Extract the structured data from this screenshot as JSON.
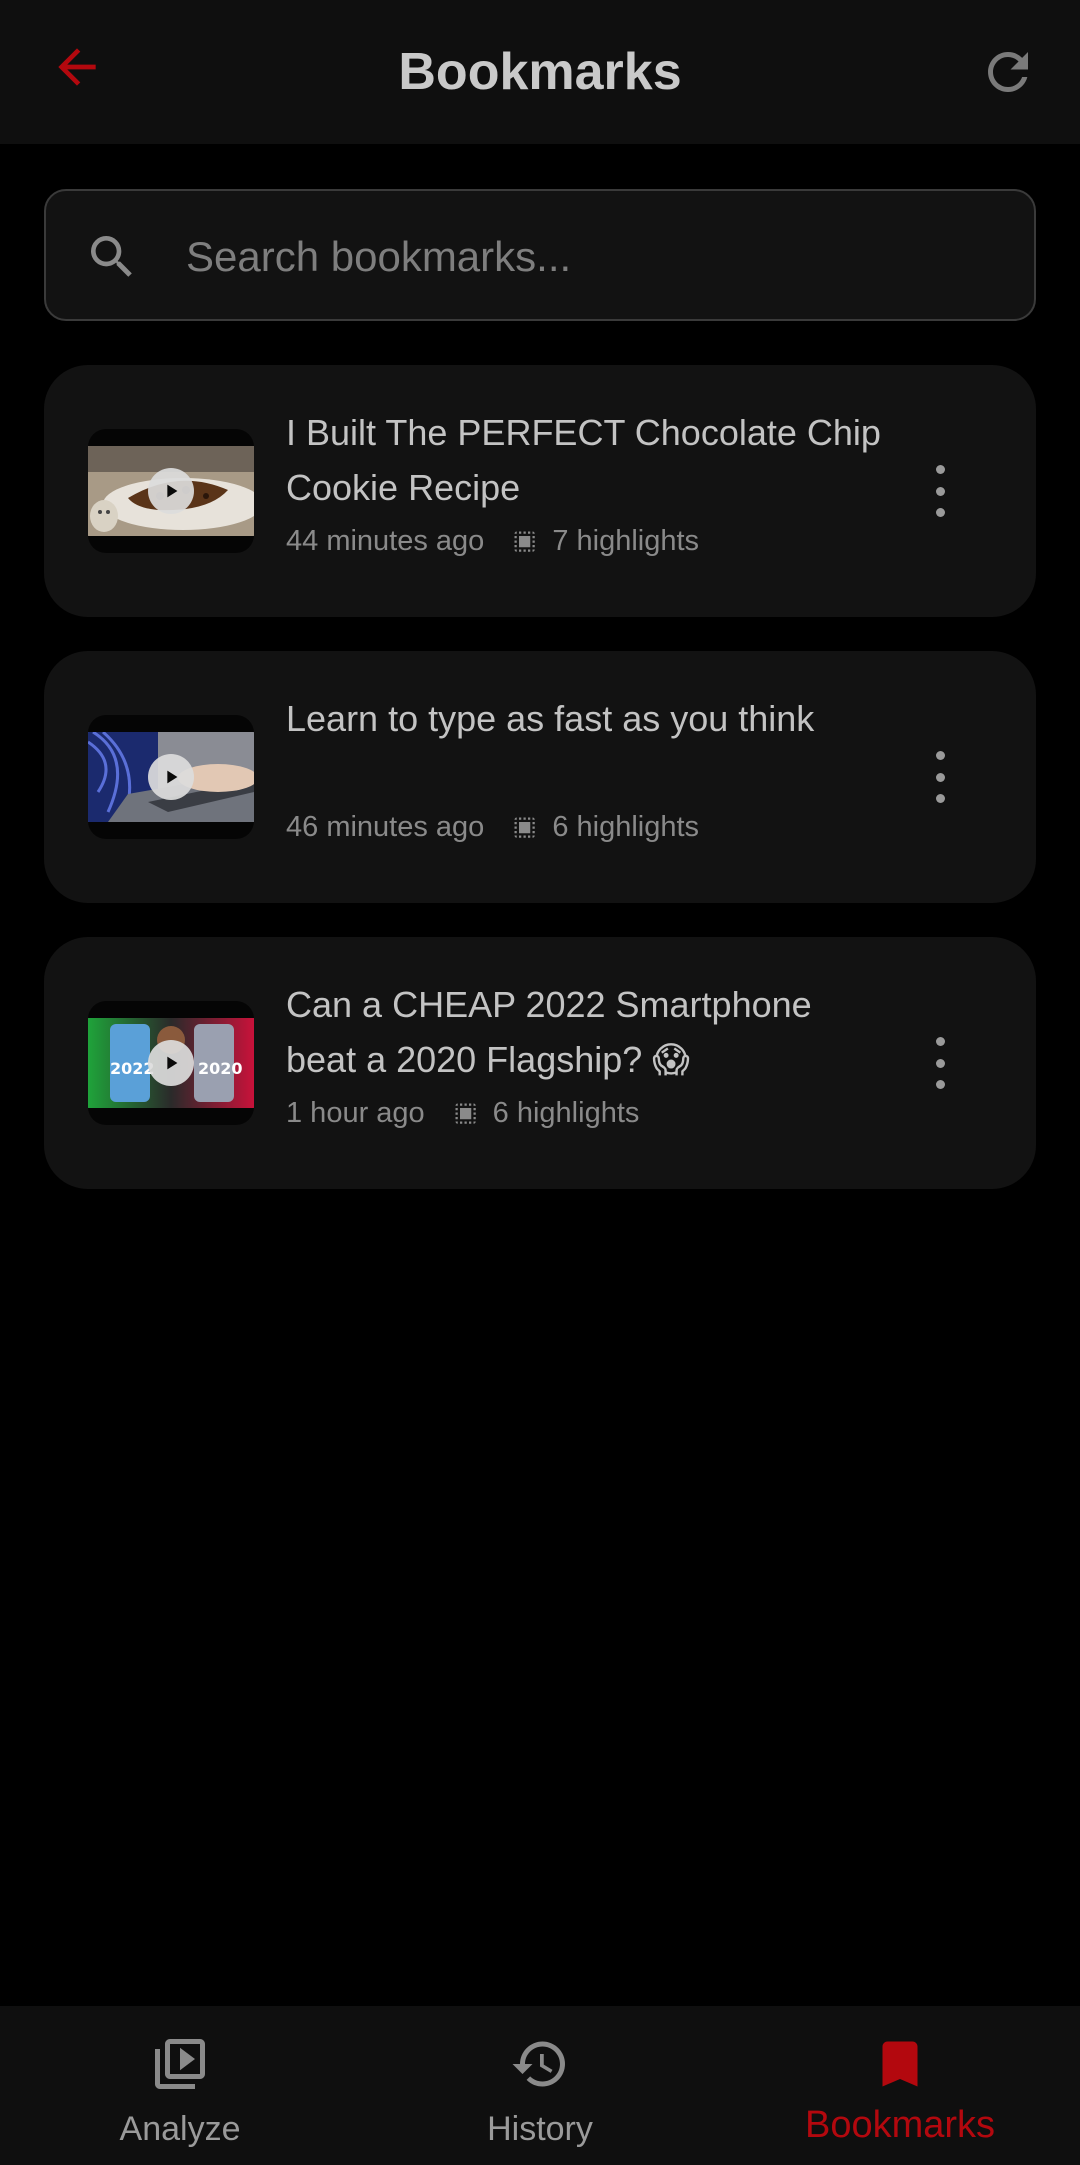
{
  "header": {
    "title": "Bookmarks",
    "back_icon": "arrow-left-icon",
    "refresh_icon": "refresh-icon"
  },
  "search": {
    "placeholder": "Search bookmarks...",
    "value": "",
    "icon": "search-icon"
  },
  "bookmarks": [
    {
      "title": "I Built The PERFECT Chocolate Chip Cookie Recipe",
      "time": "44 minutes ago",
      "highlights": "7 highlights"
    },
    {
      "title": "Learn to type as fast as you think",
      "time": "46 minutes ago",
      "highlights": "6 highlights"
    },
    {
      "title": "Can a CHEAP 2022 Smartphone beat a 2020 Flagship? 😱",
      "time": "1 hour ago",
      "highlights": "6 highlights",
      "thumb_text_left": "2022",
      "thumb_text_right": "2020"
    }
  ],
  "nav": {
    "items": [
      {
        "label": "Analyze",
        "icon": "video-library-icon",
        "active": false
      },
      {
        "label": "History",
        "icon": "history-icon",
        "active": false
      },
      {
        "label": "Bookmarks",
        "icon": "bookmark-icon",
        "active": true
      }
    ]
  },
  "colors": {
    "accent": "#b3080e",
    "background": "#000000",
    "surface": "#121212",
    "header": "#0f0f0f",
    "text_primary": "#c3c3c3",
    "text_secondary": "#8a8a8a"
  }
}
